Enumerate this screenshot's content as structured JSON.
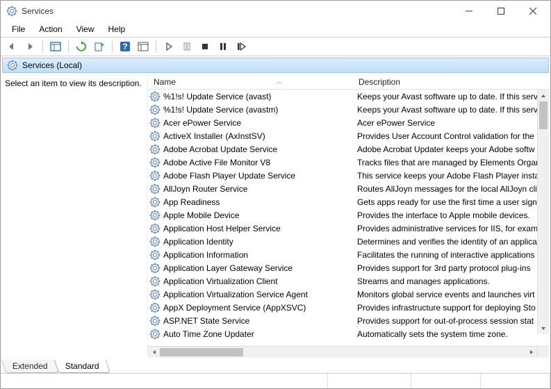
{
  "window": {
    "title": "Services"
  },
  "menu": {
    "file": "File",
    "action": "Action",
    "view": "View",
    "help": "Help"
  },
  "tree": {
    "root": "Services (Local)"
  },
  "left": {
    "prompt": "Select an item to view its description."
  },
  "columns": {
    "name": "Name",
    "description": "Description"
  },
  "tabs": {
    "extended": "Extended",
    "standard": "Standard"
  },
  "services": [
    {
      "name": "%1!s! Update Service (avast)",
      "desc": "Keeps your Avast software up to date. If this serv"
    },
    {
      "name": "%1!s! Update Service (avastm)",
      "desc": "Keeps your Avast software up to date. If this serv"
    },
    {
      "name": "Acer ePower Service",
      "desc": "Acer ePower Service"
    },
    {
      "name": "ActiveX Installer (AxInstSV)",
      "desc": "Provides User Account Control validation for the"
    },
    {
      "name": "Adobe Acrobat Update Service",
      "desc": "Adobe Acrobat Updater keeps your Adobe softw"
    },
    {
      "name": "Adobe Active File Monitor V8",
      "desc": "Tracks files that are managed by Elements Organ"
    },
    {
      "name": "Adobe Flash Player Update Service",
      "desc": "This service keeps your Adobe Flash Player insta"
    },
    {
      "name": "AllJoyn Router Service",
      "desc": "Routes AllJoyn messages for the local AllJoyn cli"
    },
    {
      "name": "App Readiness",
      "desc": "Gets apps ready for use the first time a user signs"
    },
    {
      "name": "Apple Mobile Device",
      "desc": "Provides the interface to Apple mobile devices."
    },
    {
      "name": "Application Host Helper Service",
      "desc": "Provides administrative services for IIS, for exam"
    },
    {
      "name": "Application Identity",
      "desc": "Determines and verifies the identity of an applica"
    },
    {
      "name": "Application Information",
      "desc": "Facilitates the running of interactive applications"
    },
    {
      "name": "Application Layer Gateway Service",
      "desc": "Provides support for 3rd party protocol plug-ins"
    },
    {
      "name": "Application Virtualization Client",
      "desc": "Streams and manages applications."
    },
    {
      "name": "Application Virtualization Service Agent",
      "desc": "Monitors global service events and launches virt"
    },
    {
      "name": "AppX Deployment Service (AppXSVC)",
      "desc": "Provides infrastructure support for deploying Sto"
    },
    {
      "name": "ASP.NET State Service",
      "desc": "Provides support for out-of-process session stat"
    },
    {
      "name": "Auto Time Zone Updater",
      "desc": "Automatically sets the system time zone."
    }
  ]
}
